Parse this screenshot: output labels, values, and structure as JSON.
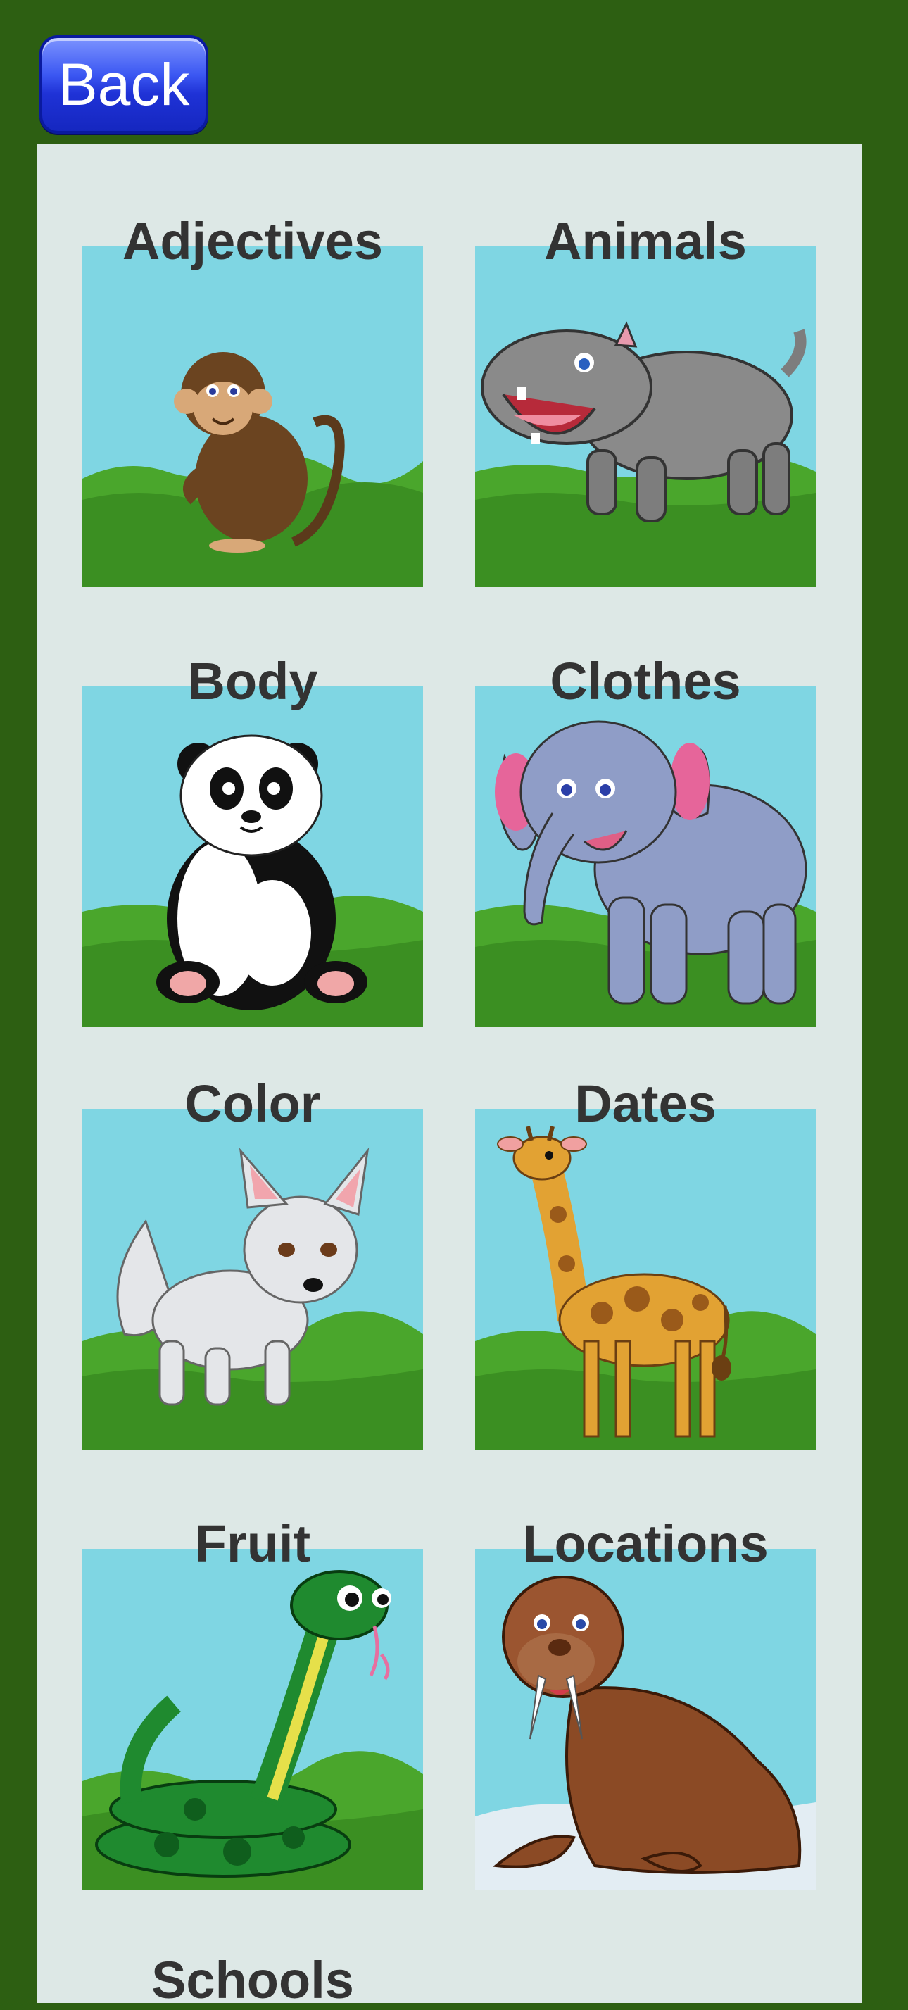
{
  "header": {
    "back_label": "Back"
  },
  "categories": [
    {
      "label": "Adjectives",
      "animal": "monkey-icon"
    },
    {
      "label": "Animals",
      "animal": "hippo-icon"
    },
    {
      "label": "Body",
      "animal": "panda-icon"
    },
    {
      "label": "Clothes",
      "animal": "elephant-icon"
    },
    {
      "label": "Color",
      "animal": "fox-icon"
    },
    {
      "label": "Dates",
      "animal": "giraffe-icon"
    },
    {
      "label": "Fruit",
      "animal": "snake-icon"
    },
    {
      "label": "Locations",
      "animal": "walrus-icon"
    },
    {
      "label": "Schools",
      "animal": ""
    }
  ],
  "colors": {
    "sky": "#7fd6e3",
    "grass": "#4aa62c",
    "frame": "#2d5f12",
    "panel": "#dde8e6"
  }
}
